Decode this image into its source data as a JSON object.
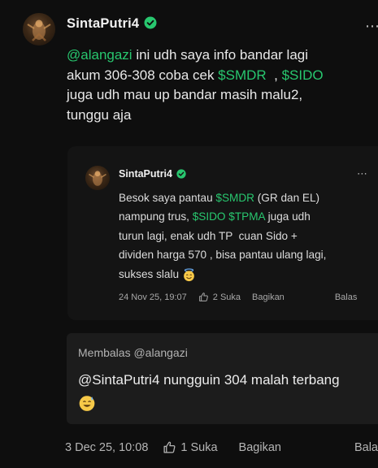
{
  "post": {
    "author": "SintaPutri4",
    "more_label": "⋯",
    "text": {
      "line1_mention": "@alangazi",
      "line1_rest": " ini udh saya info bandar lagi",
      "line2_pre": "akum 306-308 coba cek ",
      "line2_ticker1": "$SMDR",
      "line2_mid": "  , ",
      "line2_ticker2": "$SIDO",
      "line3": "juga udh mau up bandar masih malu2,",
      "line4": "tunggu aja"
    },
    "timestamp": "3 Dec 25, 10:08",
    "likes": "1 Suka",
    "share_label": "Bagikan",
    "reply_label": "Bala"
  },
  "quoted": {
    "author": "SintaPutri4",
    "more_label": "⋯",
    "text": {
      "l1_pre": "Besok saya pantau ",
      "l1_ticker": "$SMDR",
      "l1_rest": " (GR dan EL)",
      "l2_pre": "nampung trus, ",
      "l2_ticker1": "$SIDO",
      "l2_sp": " ",
      "l2_ticker2": "$TPMA",
      "l2_rest": " juga udh",
      "l3": "turun lagi, enak udh TP  cuan Sido +",
      "l4": "dividen harga 570 , bisa pantau ulang lagi,",
      "l5": "sukses slalu"
    },
    "timestamp": "24 Nov 25, 19:07",
    "likes": "2 Suka",
    "share_label": "Bagikan",
    "reply_label": "Balas"
  },
  "reply_to": {
    "label": "Membalas @alangazi",
    "text": "@SintaPutri4 nungguin 304 malah terbang"
  },
  "colors": {
    "accent": "#28c76f",
    "background": "#0e0e0e",
    "verified": "#28c76f"
  },
  "icons": [
    "verified-badge-icon",
    "more-options-icon",
    "thumbs-up-icon",
    "smiling-halo-emoji-icon",
    "sweat-smile-emoji-icon"
  ]
}
